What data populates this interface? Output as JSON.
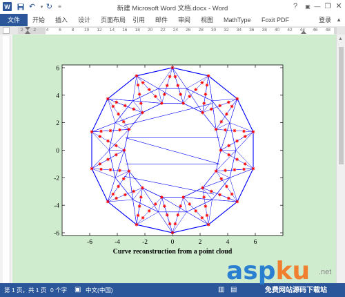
{
  "titlebar": {
    "title": "新建 Microsoft Word 文档.docx - Word",
    "logo_letter": "W",
    "help": "?",
    "minimize": "—",
    "restore": "❐",
    "close": "✕"
  },
  "ribbon": {
    "file_tab": "文件",
    "tabs": [
      "开始",
      "插入",
      "设计",
      "页面布局",
      "引用",
      "邮件",
      "审阅",
      "视图",
      "MathType",
      "Foxit PDF"
    ],
    "login": "登录"
  },
  "ruler": {
    "labels": [
      "2",
      "2",
      "4",
      "6",
      "8",
      "10",
      "12",
      "14",
      "16",
      "18",
      "20",
      "22",
      "24",
      "26",
      "28",
      "30",
      "32",
      "34",
      "36",
      "38",
      "40",
      "42",
      "44",
      "46",
      "48"
    ]
  },
  "statusbar": {
    "page": "第 1 页，共 1 页",
    "words": "0 个字",
    "lang": "中文(中国)"
  },
  "watermark": {
    "part1": "asp",
    "part2": "ku",
    "suffix": ".net",
    "sub": "免费网站源码下载站"
  },
  "colors": {
    "word_blue": "#2b579a",
    "page_bg": "#cfeccf",
    "mesh_blue": "#0000ff",
    "marker_red": "#ff0000"
  },
  "chart_data": {
    "type": "scatter",
    "title": "Curve reconstruction from a point cloud",
    "xlabel": "",
    "ylabel": "",
    "xlim": [
      -8,
      8
    ],
    "ylim": [
      -6.2,
      6.2
    ],
    "xticks": [
      -6,
      -4,
      -2,
      0,
      2,
      4,
      6
    ],
    "yticks": [
      -6,
      -4,
      -2,
      0,
      2,
      4,
      6
    ],
    "shape": "14-point star ring (outer radius 6, inner radius 3.5, inner ring radius 4.6)",
    "point_count": 112,
    "series": [
      {
        "marker": "*",
        "color": "#ff0000"
      },
      {
        "marker": "line",
        "color": "#0000ff"
      }
    ]
  }
}
